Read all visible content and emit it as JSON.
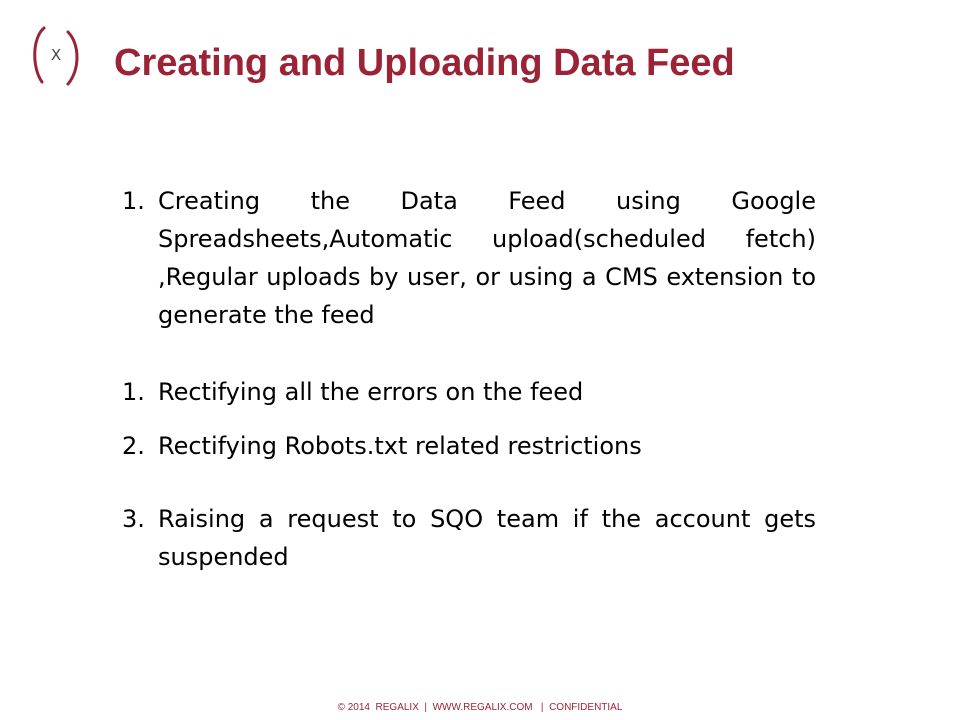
{
  "brand": {
    "accent_color": "#9b2335",
    "logo_glyph": "X"
  },
  "slide": {
    "title": "Creating and Uploading Data Feed"
  },
  "items": [
    {
      "number": "1.",
      "text": "Creating the Data Feed using Google Spreadsheets,Automatic upload(scheduled fetch) ,Regular uploads by user, or using a CMS extension to generate the feed"
    },
    {
      "number": "1.",
      "text": "Rectifying all the errors on the feed"
    },
    {
      "number": "2.",
      "text": "Rectifying Robots.txt related restrictions"
    },
    {
      "number": "3.",
      "text": "Raising a request to SQO team if the account gets suspended"
    }
  ],
  "footer": {
    "text": "© 2014  REGALIX  |  WWW.REGALIX.COM   |  CONFIDENTIAL"
  }
}
